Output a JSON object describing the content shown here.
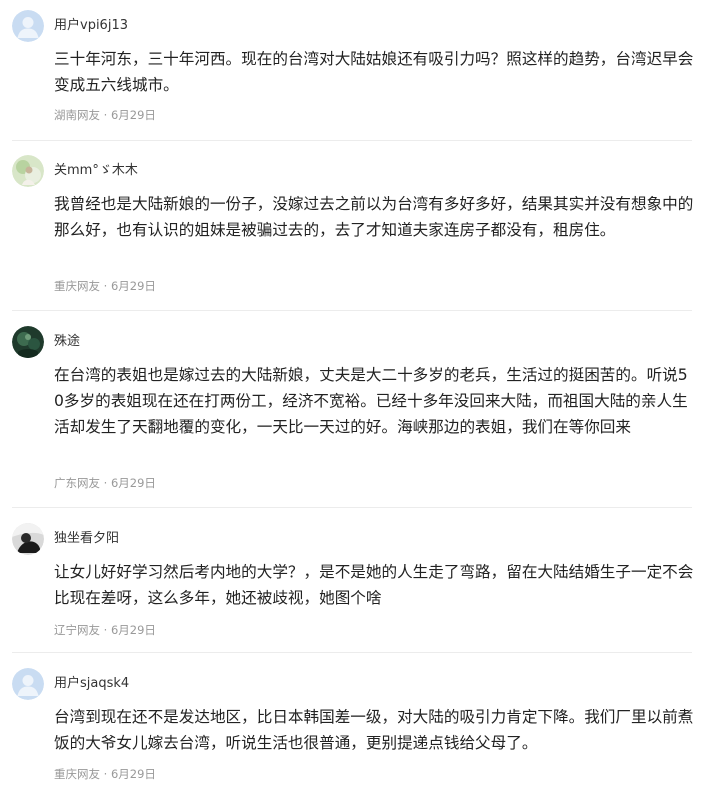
{
  "comments": [
    {
      "username": "用户vpi6j13",
      "avatar_icon": "default-user-icon",
      "text": "三十年河东，三十年河西。现在的台湾对大陆姑娘还有吸引力吗？照这样的趋势，台湾迟早会变成五六线城市。",
      "location": "湖南网友",
      "date": "6月29日"
    },
    {
      "username": "关mm°ゞ木木",
      "avatar_icon": "photo-avatar-icon",
      "text": "我曾经也是大陆新娘的一份子，没嫁过去之前以为台湾有多好多好，结果其实并没有想象中的那么好，也有认识的姐妹是被骗过去的，去了才知道夫家连房子都没有，租房住。",
      "location": "重庆网友",
      "date": "6月29日"
    },
    {
      "username": "殊途",
      "avatar_icon": "photo-avatar-icon",
      "text": "在台湾的表姐也是嫁过去的大陆新娘，丈夫是大二十多岁的老兵，生活过的挺困苦的。听说50多岁的表姐现在还在打两份工，经济不宽裕。已经十多年没回来大陆，而祖国大陆的亲人生活却发生了天翻地覆的变化，一天比一天过的好。海峡那边的表姐，我们在等你回来",
      "location": "广东网友",
      "date": "6月29日"
    },
    {
      "username": "独坐看夕阳",
      "avatar_icon": "photo-avatar-icon",
      "text": "让女儿好好学习然后考内地的大学？，是不是她的人生走了弯路，留在大陆结婚生子一定不会比现在差呀，这么多年，她还被歧视，她图个啥",
      "location": "辽宁网友",
      "date": "6月29日"
    },
    {
      "username": "用户sjaqsk4",
      "avatar_icon": "default-user-icon",
      "text": "台湾到现在还不是发达地区，比日本韩国差一级，对大陆的吸引力肯定下降。我们厂里以前煮饭的大爷女儿嫁去台湾，听说生活也很普通，更别提递点钱给父母了。",
      "location": "重庆网友",
      "date": "6月29日"
    }
  ],
  "meta_separator": " · "
}
